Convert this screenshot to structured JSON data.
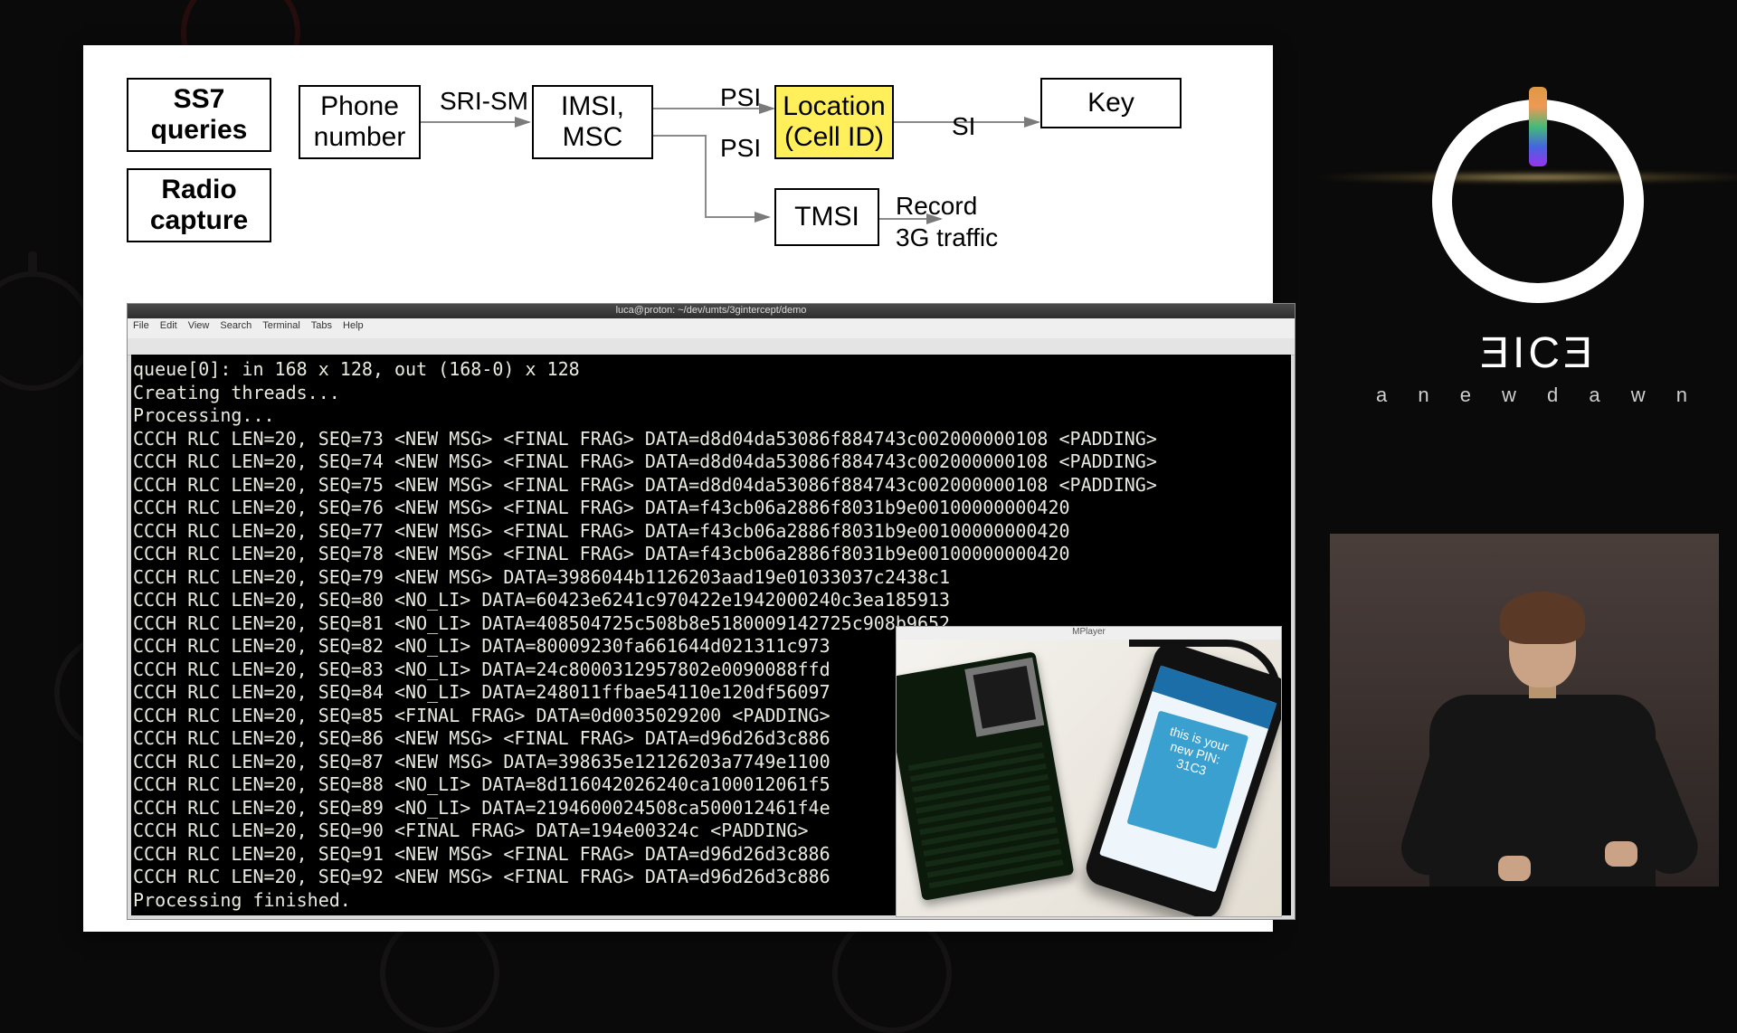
{
  "diagram": {
    "boxes": {
      "ss7": "SS7\nqueries",
      "radio": "Radio\ncapture",
      "phone": "Phone\nnumber",
      "imsi": "IMSI,\nMSC",
      "loc": "Location\n(Cell ID)",
      "tmsi": "TMSI",
      "key": "Key"
    },
    "labels": {
      "srism": "SRI-SM",
      "psi1": "PSI",
      "psi2": "PSI",
      "si": "SI",
      "rec": "Record\n3G traffic"
    }
  },
  "terminal": {
    "title": "luca@proton: ~/dev/umts/3gintercept/demo",
    "menu": [
      "File",
      "Edit",
      "View",
      "Search",
      "Terminal",
      "Tabs",
      "Help"
    ],
    "lines": [
      "queue[0]: in 168 x 128, out (168-0) x 128",
      "Creating threads...",
      "Processing...",
      "CCCH RLC LEN=20, SEQ=73 <NEW MSG> <FINAL FRAG> DATA=d8d04da53086f884743c002000000108 <PADDING>",
      "CCCH RLC LEN=20, SEQ=74 <NEW MSG> <FINAL FRAG> DATA=d8d04da53086f884743c002000000108 <PADDING>",
      "CCCH RLC LEN=20, SEQ=75 <NEW MSG> <FINAL FRAG> DATA=d8d04da53086f884743c002000000108 <PADDING>",
      "CCCH RLC LEN=20, SEQ=76 <NEW MSG> <FINAL FRAG> DATA=f43cb06a2886f8031b9e00100000000420",
      "CCCH RLC LEN=20, SEQ=77 <NEW MSG> <FINAL FRAG> DATA=f43cb06a2886f8031b9e00100000000420",
      "CCCH RLC LEN=20, SEQ=78 <NEW MSG> <FINAL FRAG> DATA=f43cb06a2886f8031b9e00100000000420",
      "CCCH RLC LEN=20, SEQ=79 <NEW MSG> DATA=3986044b1126203aad19e01033037c2438c1",
      "CCCH RLC LEN=20, SEQ=80 <NO_LI> DATA=60423e6241c970422e1942000240c3ea185913",
      "CCCH RLC LEN=20, SEQ=81 <NO_LI> DATA=408504725c508b8e5180009142725c908b9652",
      "CCCH RLC LEN=20, SEQ=82 <NO_LI> DATA=80009230fa661644d021311c973",
      "CCCH RLC LEN=20, SEQ=83 <NO_LI> DATA=24c8000312957802e0090088ffd",
      "CCCH RLC LEN=20, SEQ=84 <NO_LI> DATA=248011ffbae54110e120df56097",
      "CCCH RLC LEN=20, SEQ=85 <FINAL FRAG> DATA=0d0035029200 <PADDING>",
      "CCCH RLC LEN=20, SEQ=86 <NEW MSG> <FINAL FRAG> DATA=d96d26d3c886",
      "CCCH RLC LEN=20, SEQ=87 <NEW MSG> DATA=398635e12126203a7749e1100",
      "CCCH RLC LEN=20, SEQ=88 <NO_LI> DATA=8d116042026240ca100012061f5",
      "CCCH RLC LEN=20, SEQ=89 <NO_LI> DATA=2194600024508ca500012461f4e",
      "CCCH RLC LEN=20, SEQ=90 <FINAL FRAG> DATA=194e00324c <PADDING>",
      "CCCH RLC LEN=20, SEQ=91 <NEW MSG> <FINAL FRAG> DATA=d96d26d3c886",
      "CCCH RLC LEN=20, SEQ=92 <NEW MSG> <FINAL FRAG> DATA=d96d26d3c886",
      "Processing finished."
    ]
  },
  "photo": {
    "win_title": "MPlayer",
    "sms": "this is\nyour new\nPIN: 31C3"
  },
  "brand": {
    "name": "ƎICƎ",
    "tagline": "a  n e w  d a w n"
  }
}
